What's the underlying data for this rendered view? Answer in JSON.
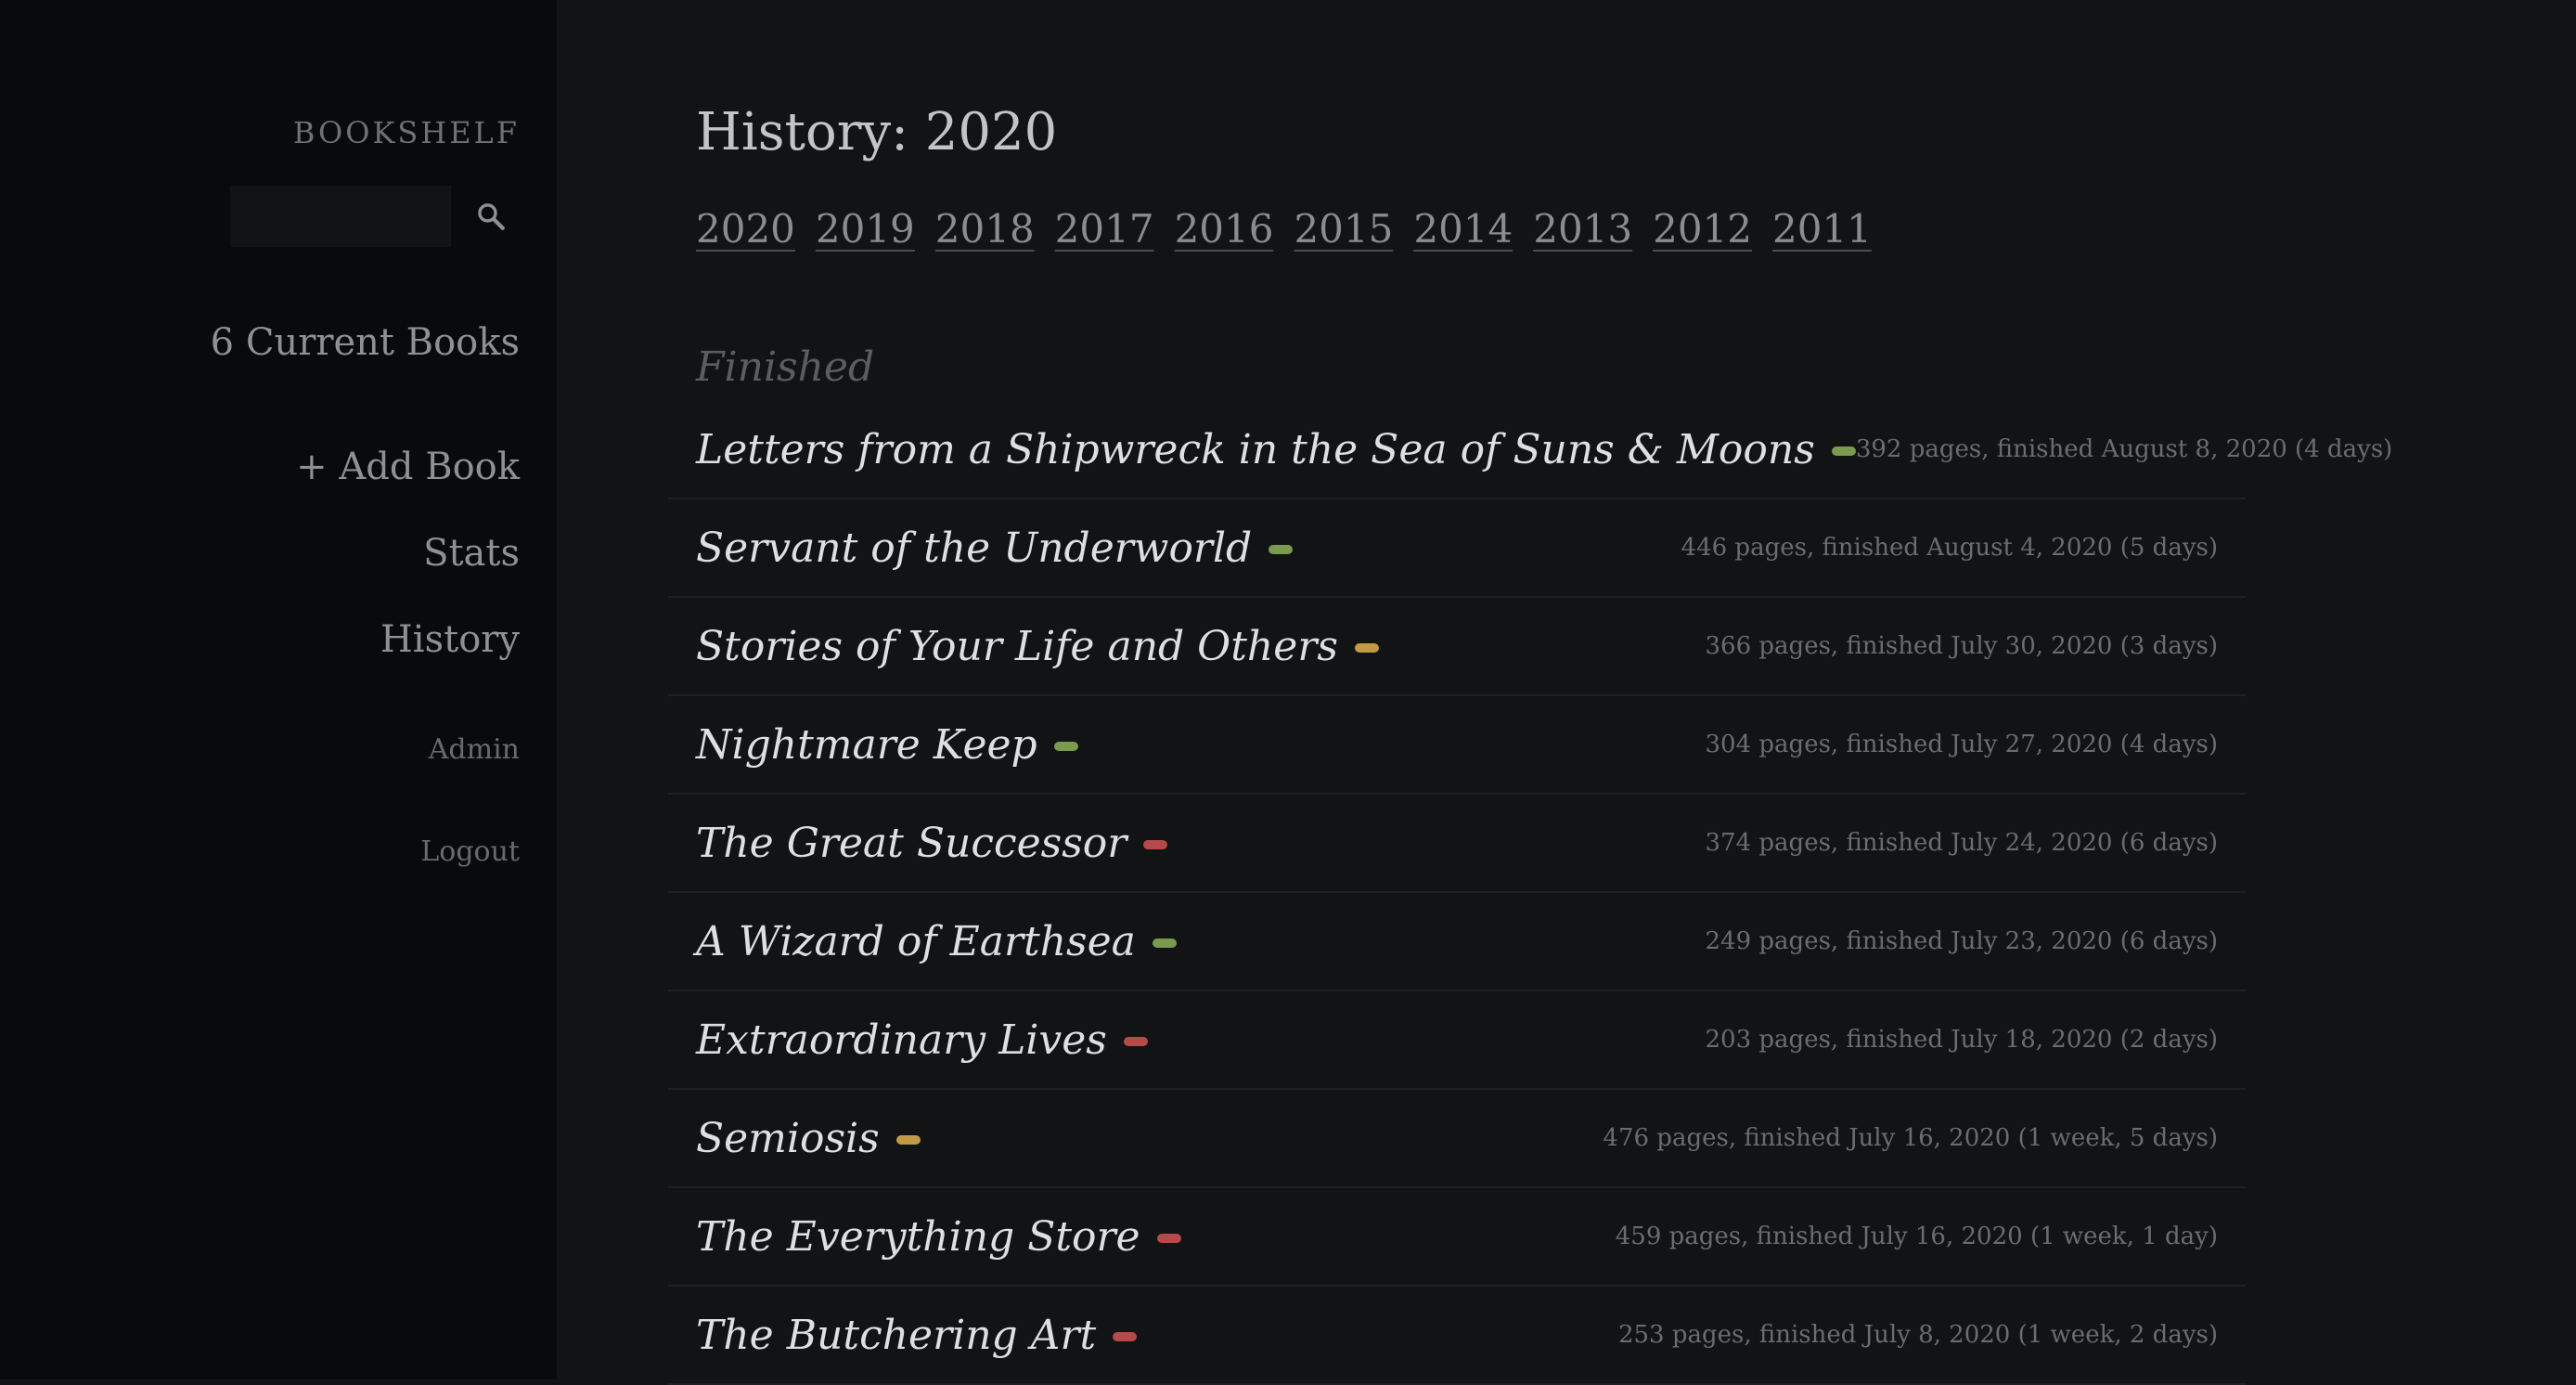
{
  "sidebar": {
    "brand": "BOOKSHELF",
    "search": {
      "value": "",
      "placeholder": "",
      "icon": "search-icon"
    },
    "current_books": "6 Current Books",
    "add_book": "+ Add Book",
    "stats": "Stats",
    "history": "History",
    "admin": "Admin",
    "logout": "Logout"
  },
  "main": {
    "title": "History: 2020",
    "years": [
      "2020",
      "2019",
      "2018",
      "2017",
      "2016",
      "2015",
      "2014",
      "2013",
      "2012",
      "2011"
    ],
    "section_heading": "Finished",
    "books": [
      {
        "title": "Letters from a Shipwreck in the Sea of Suns & Moons",
        "rating_color": "#7a9a4e",
        "meta": "392 pages, finished August 8, 2020 (4 days)"
      },
      {
        "title": "Servant of the Underworld",
        "rating_color": "#7a9a4e",
        "meta": "446 pages, finished August 4, 2020 (5 days)"
      },
      {
        "title": "Stories of Your Life and Others",
        "rating_color": "#c29a46",
        "meta": "366 pages, finished July 30, 2020 (3 days)"
      },
      {
        "title": "Nightmare Keep",
        "rating_color": "#7a9a4e",
        "meta": "304 pages, finished July 27, 2020 (4 days)"
      },
      {
        "title": "The Great Successor",
        "rating_color": "#b54a4a",
        "meta": "374 pages, finished July 24, 2020 (6 days)"
      },
      {
        "title": "A Wizard of Earthsea",
        "rating_color": "#7a9a4e",
        "meta": "249 pages, finished July 23, 2020 (6 days)"
      },
      {
        "title": "Extraordinary Lives",
        "rating_color": "#b54a4a",
        "meta": "203 pages, finished July 18, 2020 (2 days)"
      },
      {
        "title": "Semiosis",
        "rating_color": "#c29a46",
        "meta": "476 pages, finished July 16, 2020 (1 week, 5 days)"
      },
      {
        "title": "The Everything Store",
        "rating_color": "#b54a4a",
        "meta": "459 pages, finished July 16, 2020 (1 week, 1 day)"
      },
      {
        "title": "The Butchering Art",
        "rating_color": "#b54a4a",
        "meta": "253 pages, finished July 8, 2020 (1 week, 2 days)"
      }
    ]
  }
}
